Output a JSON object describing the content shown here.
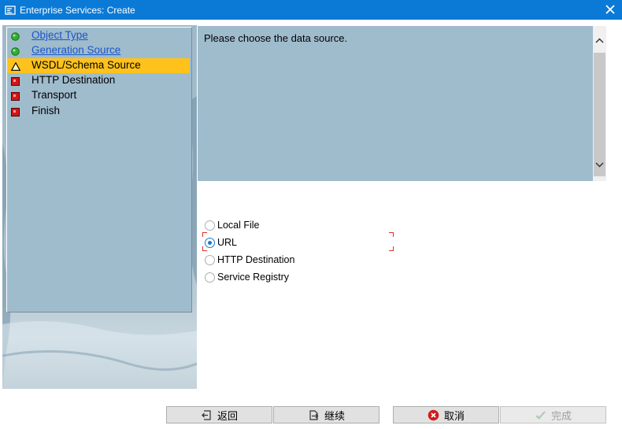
{
  "window": {
    "title": "Enterprise Services: Create"
  },
  "steps": [
    {
      "label": "Object Type",
      "status": "complete",
      "link": true
    },
    {
      "label": "Generation Source",
      "status": "complete",
      "link": true
    },
    {
      "label": "WSDL/Schema Source",
      "status": "warning",
      "link": false,
      "active": true
    },
    {
      "label": "HTTP Destination",
      "status": "pending",
      "link": false
    },
    {
      "label": "Transport",
      "status": "pending",
      "link": false
    },
    {
      "label": "Finish",
      "status": "pending",
      "link": false
    }
  ],
  "message": {
    "text": "Please choose the data source."
  },
  "source_options": [
    {
      "label": "Local File",
      "checked": false
    },
    {
      "label": "URL",
      "checked": true
    },
    {
      "label": "HTTP Destination",
      "checked": false
    },
    {
      "label": "Service Registry",
      "checked": false
    }
  ],
  "buttons": {
    "back": "返回",
    "continue": "继续",
    "cancel": "取消",
    "complete": "完成"
  },
  "colors": {
    "titlebar": "#0a7ad6",
    "panel": "#9fbccd",
    "active_step": "#ffc21c",
    "link": "#1a55c8",
    "status_complete": "#2fb12f",
    "status_pending": "#d01818",
    "status_warning": "#f2c200"
  }
}
